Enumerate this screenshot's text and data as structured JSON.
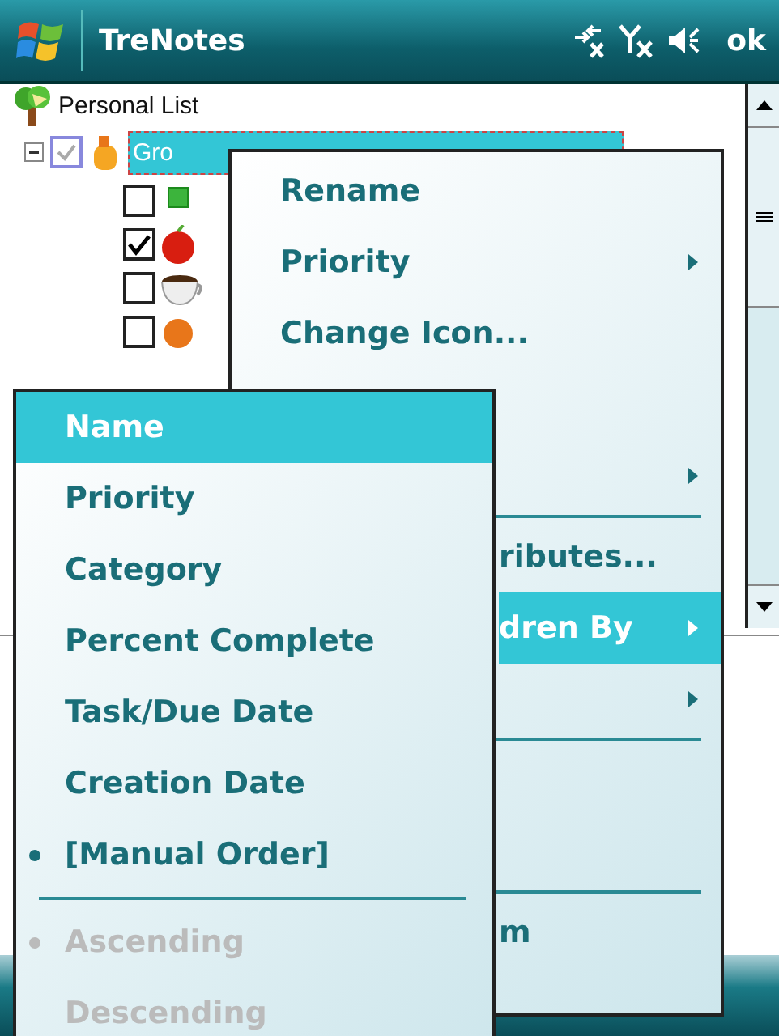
{
  "title_bar": {
    "title": "TreNotes",
    "ok": "ok"
  },
  "tree": {
    "root": "Personal List",
    "children": [
      {
        "label": "Gro",
        "checked": true,
        "expanded": true,
        "selected": true,
        "children": [
          {
            "checked": false
          },
          {
            "checked": true
          },
          {
            "checked": false
          },
          {
            "checked": false
          }
        ]
      }
    ]
  },
  "context_menu": {
    "items": [
      {
        "kind": "item",
        "label": "Rename",
        "submenu": false,
        "selected": false
      },
      {
        "kind": "item",
        "label": "Priority",
        "submenu": true,
        "selected": false
      },
      {
        "kind": "item",
        "label": "Change Icon...",
        "submenu": false,
        "selected": false
      },
      {
        "kind": "blank"
      },
      {
        "kind": "hidden",
        "submenu": true
      },
      {
        "kind": "separator"
      },
      {
        "kind": "partial",
        "label": "ributes...",
        "submenu": false,
        "selected": false
      },
      {
        "kind": "partial",
        "label": "dren By",
        "submenu": true,
        "selected": true
      },
      {
        "kind": "hidden",
        "submenu": true
      },
      {
        "kind": "separator"
      },
      {
        "kind": "blank"
      },
      {
        "kind": "blank"
      },
      {
        "kind": "separator"
      },
      {
        "kind": "partial",
        "label": "m",
        "submenu": false,
        "selected": false
      }
    ]
  },
  "sort_submenu": {
    "items": [
      {
        "kind": "item",
        "label": "Name",
        "selected": true,
        "bullet": false,
        "disabled": false
      },
      {
        "kind": "item",
        "label": "Priority",
        "selected": false,
        "bullet": false,
        "disabled": false
      },
      {
        "kind": "item",
        "label": "Category",
        "selected": false,
        "bullet": false,
        "disabled": false
      },
      {
        "kind": "item",
        "label": "Percent Complete",
        "selected": false,
        "bullet": false,
        "disabled": false
      },
      {
        "kind": "item",
        "label": "Task/Due Date",
        "selected": false,
        "bullet": false,
        "disabled": false
      },
      {
        "kind": "item",
        "label": "Creation Date",
        "selected": false,
        "bullet": false,
        "disabled": false
      },
      {
        "kind": "item",
        "label": "[Manual Order]",
        "selected": false,
        "bullet": true,
        "disabled": false
      },
      {
        "kind": "separator"
      },
      {
        "kind": "item",
        "label": "Ascending",
        "selected": false,
        "bullet": true,
        "disabled": true
      },
      {
        "kind": "item",
        "label": "Descending",
        "selected": false,
        "bullet": false,
        "disabled": true
      }
    ]
  }
}
